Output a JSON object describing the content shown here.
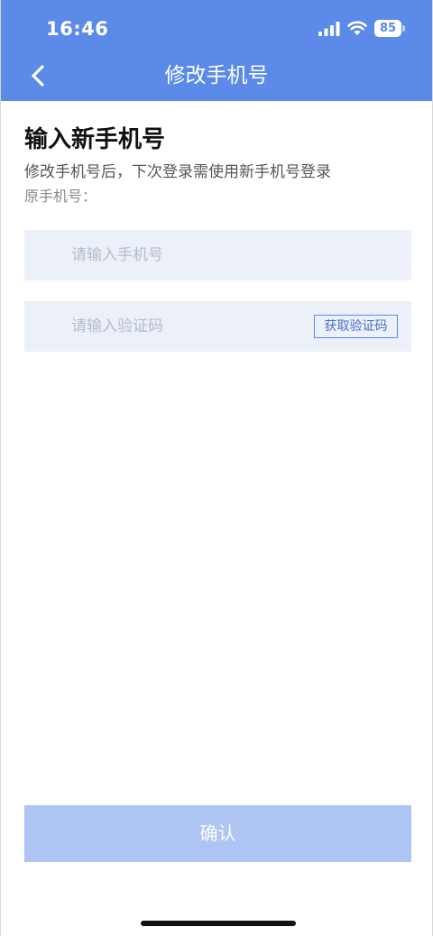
{
  "status_bar": {
    "time": "16:46",
    "battery_level": "85",
    "icons": [
      "signal-icon",
      "wifi-icon",
      "battery-icon"
    ]
  },
  "nav": {
    "title": "修改手机号",
    "back_icon": "chevron-left-icon"
  },
  "content": {
    "heading": "输入新手机号",
    "subtitle": "修改手机号后，下次登录需使用新手机号登录",
    "original_phone_label": "原手机号："
  },
  "form": {
    "phone_placeholder": "请输入手机号",
    "phone_value": "",
    "code_placeholder": "请输入验证码",
    "code_value": "",
    "get_code_label": "获取验证码"
  },
  "footer": {
    "confirm_label": "确认"
  },
  "colors": {
    "primary": "#5b8ae8",
    "field_background": "#ecf0f8",
    "confirm_disabled": "#aec4f3"
  }
}
